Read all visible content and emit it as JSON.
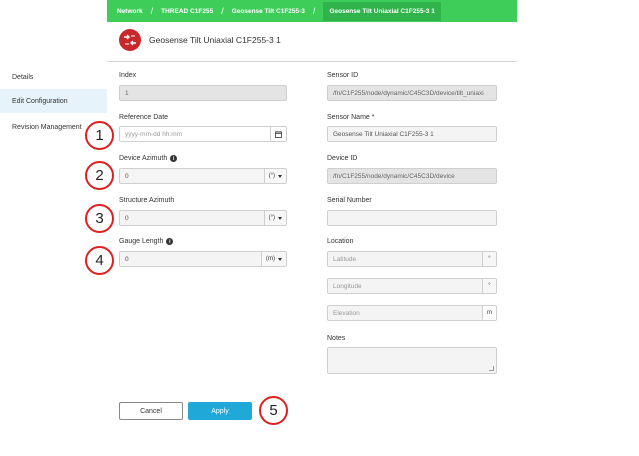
{
  "breadcrumb": [
    {
      "label": "Network"
    },
    {
      "label": "THREAD C1F255"
    },
    {
      "label": "Geosense Tilt C1F255-3"
    },
    {
      "label": "Geosense Tilt Uniaxial C1F255-3 1"
    }
  ],
  "breadcrumb_sep": "/",
  "header": {
    "title": "Geosense Tilt Uniaxial C1F255-3 1"
  },
  "sidebar": {
    "items": [
      {
        "label": "Details"
      },
      {
        "label": "Edit Configuration"
      },
      {
        "label": "Revision Management"
      }
    ]
  },
  "form": {
    "index": {
      "label": "Index",
      "value": "1"
    },
    "reference_date": {
      "label": "Reference Date",
      "placeholder": "yyyy-mm-dd hh:mm"
    },
    "device_azimuth": {
      "label": "Device Azimuth",
      "value": "0",
      "unit": "(°)"
    },
    "structure_azimuth": {
      "label": "Structure Azimuth",
      "value": "0",
      "unit": "(°)"
    },
    "gauge_length": {
      "label": "Gauge Length",
      "value": "0",
      "unit": "(m)"
    },
    "sensor_id": {
      "label": "Sensor ID",
      "value": "/fn/C1F255/node/dynamic/C45C3D/device/tilt_uniaxi"
    },
    "sensor_name": {
      "label": "Sensor Name *",
      "value": "Geosense Tilt Uniaxial C1F255-3 1"
    },
    "device_id": {
      "label": "Device ID",
      "value": "/fn/C1F255/node/dynamic/C45C3D/device"
    },
    "serial_number": {
      "label": "Serial Number",
      "value": ""
    },
    "location": {
      "label": "Location",
      "latitude_placeholder": "Latitude",
      "longitude_placeholder": "Longitude",
      "elevation_placeholder": "Elevation",
      "degree_unit": "°",
      "elevation_unit": "m"
    },
    "notes": {
      "label": "Notes",
      "value": ""
    }
  },
  "buttons": {
    "cancel": "Cancel",
    "apply": "Apply"
  },
  "annotations": [
    "1",
    "2",
    "3",
    "4",
    "5"
  ],
  "colors": {
    "topbar": "#3dcd58",
    "apply": "#1fa8d8",
    "annotation": "#e02020",
    "device_icon": "#c8272b"
  }
}
